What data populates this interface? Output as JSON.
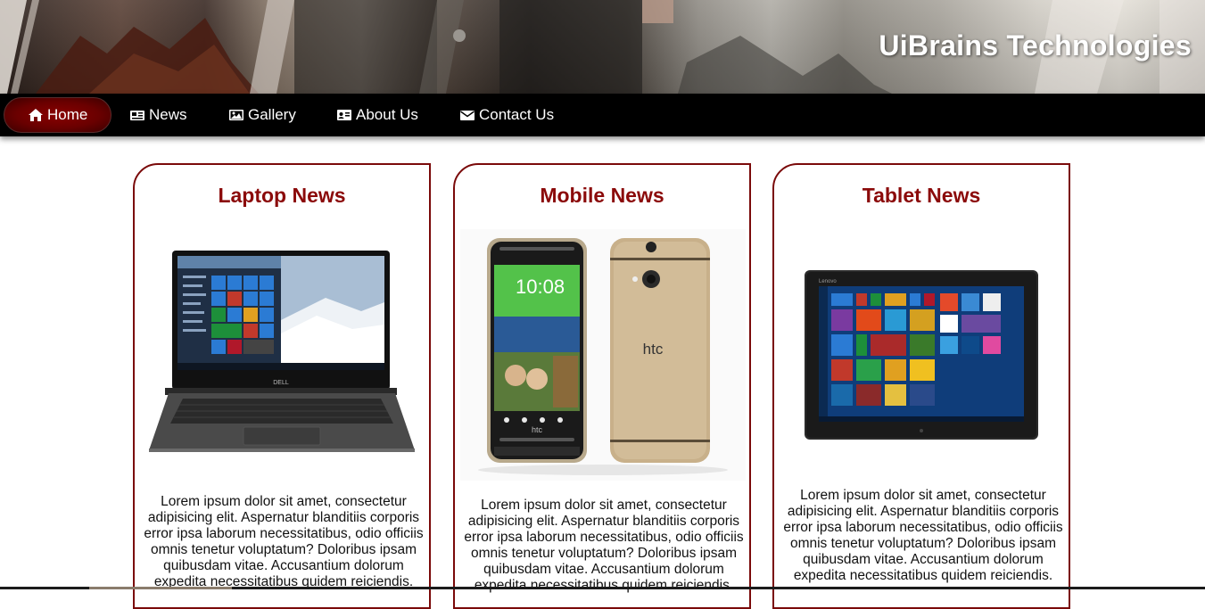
{
  "header": {
    "title": "UiBrains Technologies"
  },
  "nav": {
    "items": [
      {
        "label": "Home",
        "icon": "home-icon",
        "active": true
      },
      {
        "label": "News",
        "icon": "newspaper-icon",
        "active": false
      },
      {
        "label": "Gallery",
        "icon": "image-icon",
        "active": false
      },
      {
        "label": "About Us",
        "icon": "id-card-icon",
        "active": false
      },
      {
        "label": "Contact Us",
        "icon": "envelope-icon",
        "active": false
      }
    ]
  },
  "cards": [
    {
      "title": "Laptop News",
      "text": "Lorem ipsum dolor sit amet, consectetur adipisicing elit. Aspernatur blanditiis corporis error ipsa laborum necessitatibus, odio officiis omnis tenetur voluptatum? Doloribus ipsam quibusdam vitae. Accusantium dolorum expedita necessitatibus quidem reiciendis.",
      "brand": "DELL"
    },
    {
      "title": "Mobile News",
      "text": "Lorem ipsum dolor sit amet, consectetur adipisicing elit. Aspernatur blanditiis corporis error ipsa laborum necessitatibus, odio officiis omnis tenetur voluptatum? Doloribus ipsam quibusdam vitae. Accusantium dolorum expedita necessitatibus quidem reiciendis.",
      "brand": "htc",
      "time": "10:08"
    },
    {
      "title": "Tablet News",
      "text": "Lorem ipsum dolor sit amet, consectetur adipisicing elit. Aspernatur blanditiis corporis error ipsa laborum necessitatibus, odio officiis omnis tenetur voluptatum? Doloribus ipsam quibusdam vitae. Accusantium dolorum expedita necessitatibus quidem reiciendis.",
      "brand": "Lenovo"
    }
  ],
  "colors": {
    "accent": "#8b0a0a",
    "nav_bg": "#000000",
    "active_tab": "#7a0000"
  }
}
